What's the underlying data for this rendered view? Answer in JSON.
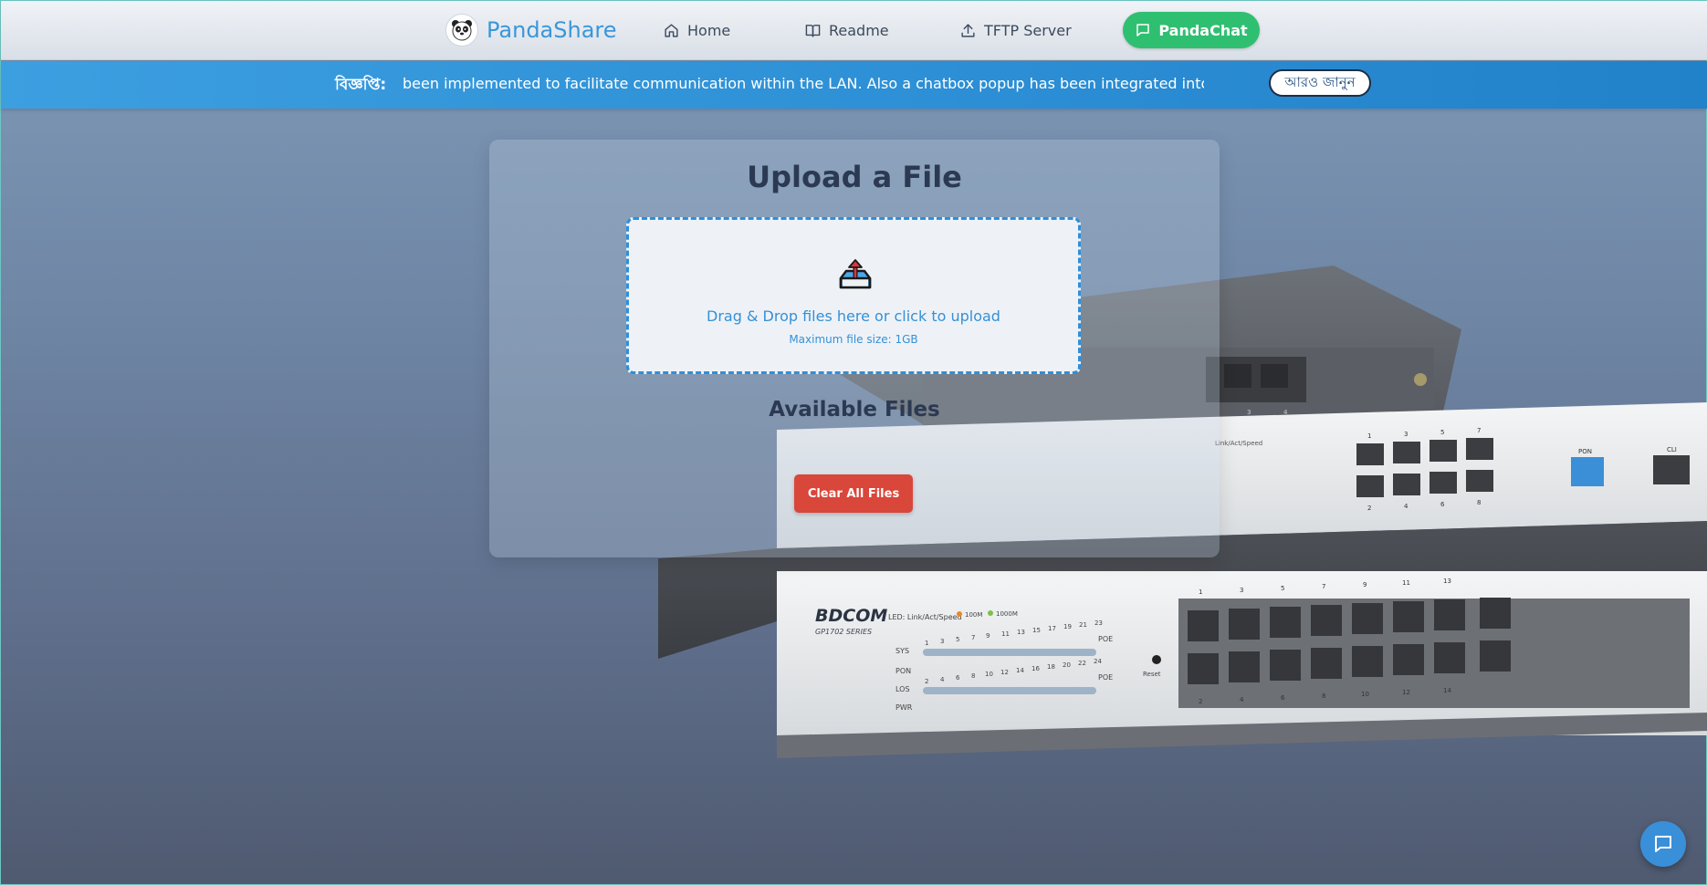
{
  "nav": {
    "brand": "PandaShare",
    "items": [
      {
        "label": "Home",
        "icon": "home-icon"
      },
      {
        "label": "Readme",
        "icon": "book-icon"
      },
      {
        "label": "TFTP Server",
        "icon": "upload-icon"
      }
    ],
    "chat_label": "PandaChat",
    "chat_color": "#2fbf71",
    "brand_color": "#3a96d9"
  },
  "notice": {
    "label": "বিজ্ঞপ্তি:",
    "text": "been implemented to facilitate communication within the LAN. Also a chatbox popup has been integrated into PandaShare.",
    "button_label": "আরও জানুন"
  },
  "upload": {
    "title": "Upload a File",
    "dropzone_text": "Drag & Drop files here or click to upload",
    "dropzone_subtext": "Maximum file size: 1GB"
  },
  "files": {
    "title": "Available Files",
    "clear_label": "Clear All Files",
    "clear_color": "#d9463a"
  },
  "device": {
    "brand": "BDCOM",
    "model": "GP1702 SERIES",
    "led_label": "LED: Link/Act/Speed",
    "legend_100m": "100M",
    "legend_1000m": "1000M",
    "status_labels": [
      "SYS",
      "PON",
      "LOS",
      "PWR"
    ],
    "poe_label": "POE",
    "reset_label": "Reset",
    "top_port_numbers": [
      "1",
      "3",
      "5",
      "7",
      "9",
      "11",
      "13"
    ],
    "bottom_port_numbers": [
      "2",
      "4",
      "6",
      "8",
      "10",
      "12",
      "14"
    ],
    "led_odd_numbers": [
      "1",
      "3",
      "5",
      "7",
      "9",
      "11",
      "13",
      "15",
      "17",
      "19",
      "21",
      "23"
    ],
    "led_even_numbers": [
      "2",
      "4",
      "6",
      "8",
      "10",
      "12",
      "14",
      "16",
      "18",
      "20",
      "22",
      "24"
    ],
    "mid_led_label": "Link/Act/Speed",
    "mid_top_ports": [
      "1",
      "3",
      "5",
      "7"
    ],
    "mid_bottom_ports": [
      "2",
      "4",
      "6",
      "8"
    ],
    "mid_pon_label": "PON",
    "mid_cli_label": "CLI",
    "back_port_numbers": [
      "3",
      "4"
    ]
  }
}
